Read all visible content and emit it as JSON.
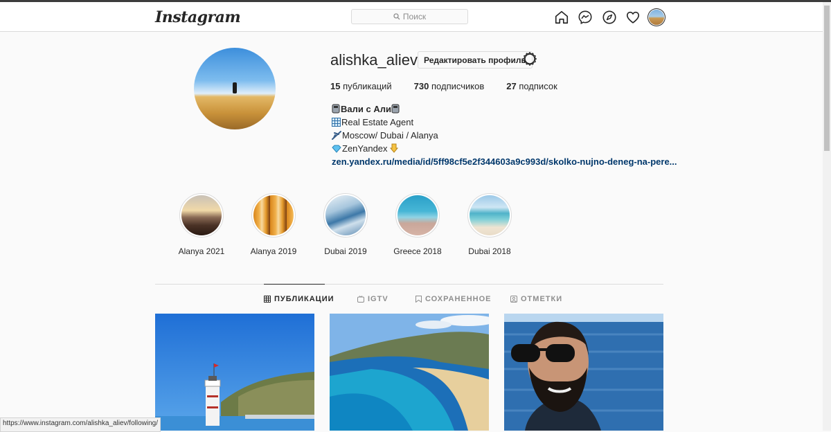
{
  "app": {
    "logo_text": "Instagram"
  },
  "header": {
    "search_placeholder": "Поиск",
    "icons": [
      "home-icon",
      "messenger-icon",
      "explore-icon",
      "heart-icon"
    ]
  },
  "profile": {
    "username": "alishka_aliev",
    "edit_button": "Редактировать профиль",
    "stats": [
      {
        "count": "15",
        "label": "публикаций"
      },
      {
        "count": "730",
        "label": "подписчиков"
      },
      {
        "count": "27",
        "label": "подписок"
      }
    ],
    "bio": {
      "name": "Вали с Али",
      "lines": [
        "Real Estate Agent",
        "Moscow/ Dubai / Alanya",
        "ZenYandex"
      ],
      "link": "zen.yandex.ru/media/id/5ff98cf5e2f344603a9c993d/skolko-nujno-deneg-na-pere..."
    }
  },
  "highlights": [
    {
      "label": "Alanya 2021"
    },
    {
      "label": "Alanya 2019"
    },
    {
      "label": "Dubai 2019"
    },
    {
      "label": "Greece 2018"
    },
    {
      "label": "Dubai 2018"
    }
  ],
  "tabs": [
    {
      "label": "ПУБЛИКАЦИИ",
      "active": true
    },
    {
      "label": "IGTV",
      "active": false
    },
    {
      "label": "СОХРАНЕННОЕ",
      "active": false
    },
    {
      "label": "ОТМЕТКИ",
      "active": false
    }
  ],
  "status_bar": {
    "url": "https://www.instagram.com/alishka_aliev/following/"
  },
  "colors": {
    "link": "#00376b",
    "border": "#dbdbdb",
    "text": "#262626",
    "muted": "#8e8e8e"
  }
}
